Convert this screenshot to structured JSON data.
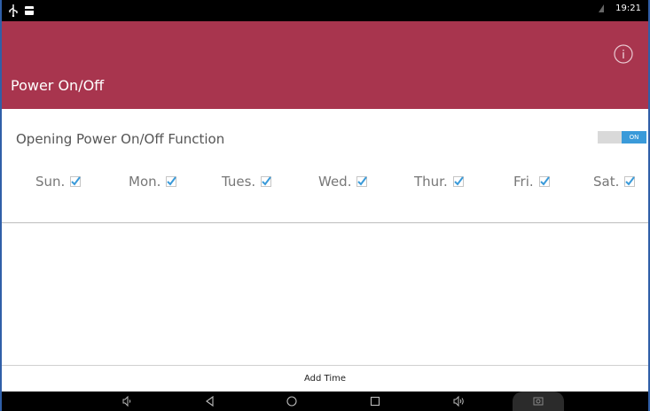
{
  "status_bar": {
    "time": "19:21"
  },
  "app_bar": {
    "title": "Power On/Off",
    "accent_color": "#a8354e"
  },
  "function": {
    "label": "Opening Power On/Off Function",
    "toggle_state": "ON",
    "toggle_color": "#3a9ad9"
  },
  "days": [
    {
      "label": "Sun.",
      "checked": true
    },
    {
      "label": "Mon.",
      "checked": true
    },
    {
      "label": "Tues.",
      "checked": true
    },
    {
      "label": "Wed.",
      "checked": true
    },
    {
      "label": "Thur.",
      "checked": true
    },
    {
      "label": "Fri.",
      "checked": true
    },
    {
      "label": "Sat.",
      "checked": true
    }
  ],
  "footer": {
    "add_time_label": "Add Time"
  },
  "icons": {
    "status_left": [
      "usb-icon",
      "notification-icon"
    ],
    "status_right": [
      "signal-icon"
    ],
    "app_bar": "info-icon",
    "nav": [
      "volume-down-icon",
      "back-icon",
      "home-icon",
      "recents-icon",
      "volume-up-icon",
      "screenshot-icon"
    ]
  }
}
